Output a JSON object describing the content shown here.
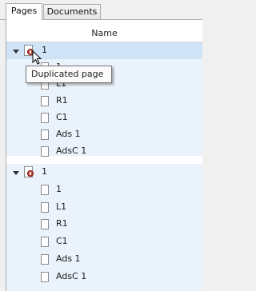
{
  "tabs": [
    {
      "label": "Pages",
      "active": true
    },
    {
      "label": "Documents",
      "active": false
    }
  ],
  "list": {
    "column_header": "Name",
    "groups": [
      {
        "label": "1",
        "expanded": true,
        "selected": true,
        "icon": "page-warning-icon",
        "children": [
          "1",
          "L1",
          "R1",
          "C1",
          "Ads 1",
          "AdsC 1"
        ]
      },
      {
        "label": "1",
        "expanded": true,
        "selected": false,
        "icon": "page-warning-icon",
        "children": [
          "1",
          "L1",
          "R1",
          "C1",
          "Ads 1",
          "AdsC 1"
        ]
      }
    ]
  },
  "tooltip": {
    "text": "Duplicated page"
  },
  "colors": {
    "selection": "#cfe4f7",
    "group_background": "#eaf2fb",
    "warning": "#c0392b"
  }
}
